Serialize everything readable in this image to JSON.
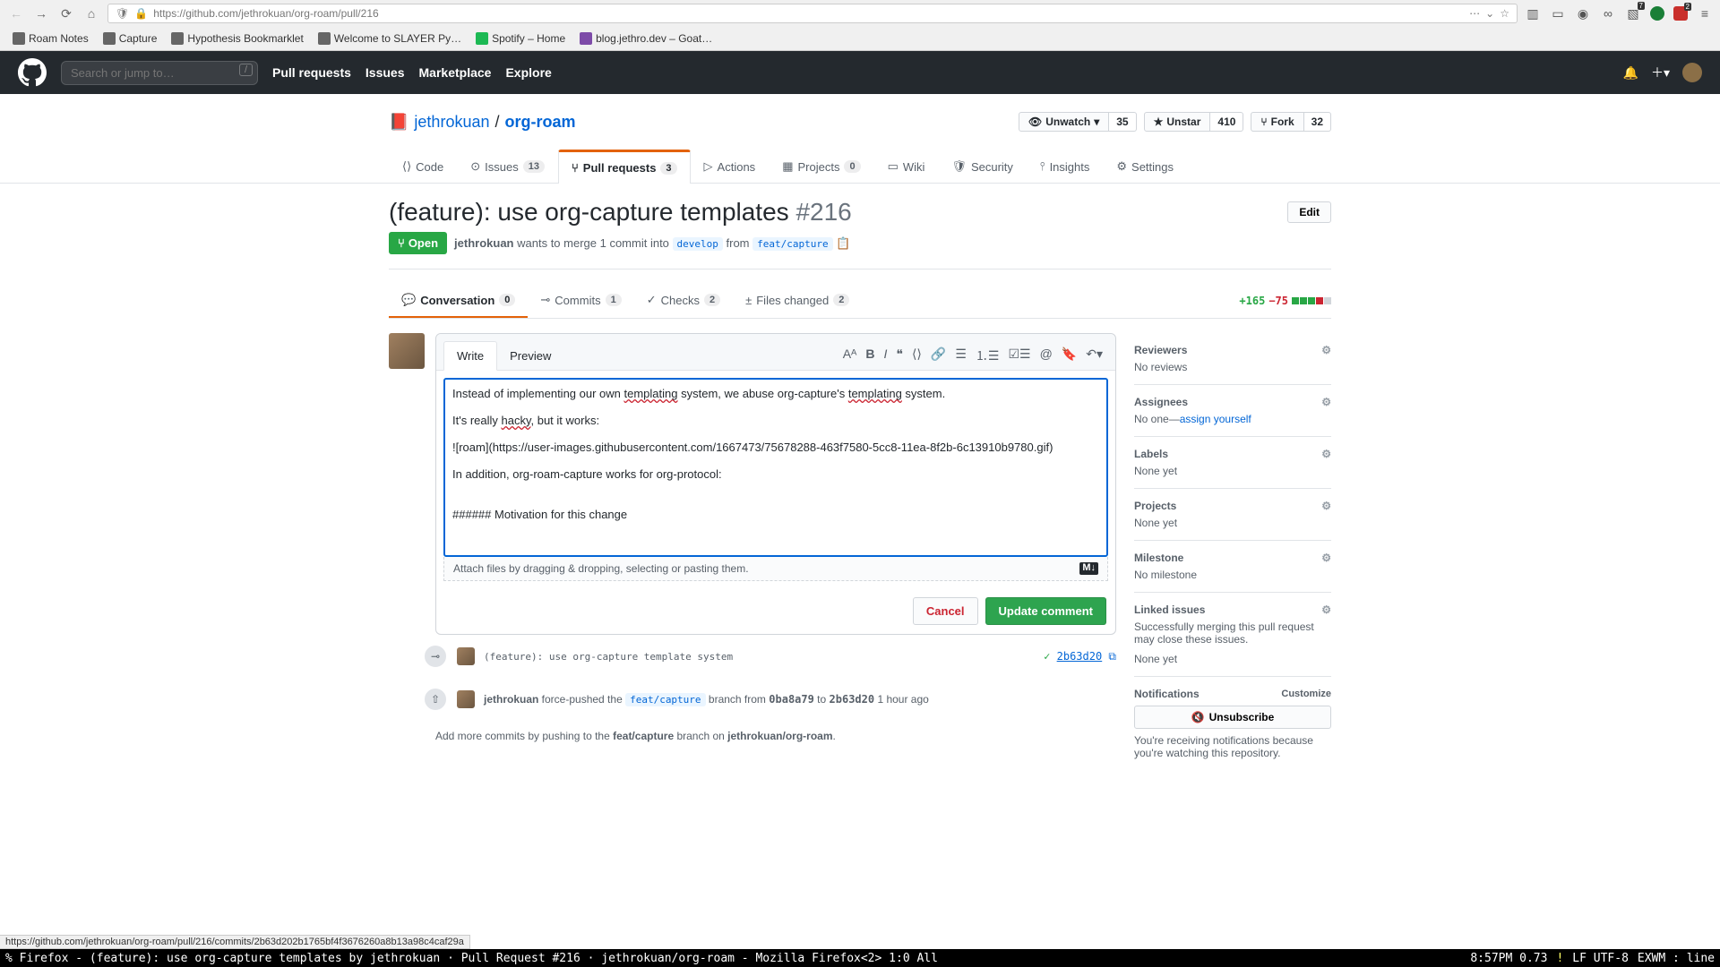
{
  "browser": {
    "url": "https://github.com/jethrokuan/org-roam/pull/216",
    "bookmarks": [
      "Roam Notes",
      "Capture",
      "Hypothesis Bookmarklet",
      "Welcome to SLAYER Py…",
      "Spotify – Home",
      "blog.jethro.dev – Goat…"
    ],
    "ext_badge": "7"
  },
  "gh_header": {
    "search_placeholder": "Search or jump to…",
    "nav": [
      "Pull requests",
      "Issues",
      "Marketplace",
      "Explore"
    ]
  },
  "repo": {
    "owner": "jethrokuan",
    "name": "org-roam",
    "watch_label": "Unwatch",
    "watch_count": "35",
    "star_label": "Unstar",
    "star_count": "410",
    "fork_label": "Fork",
    "fork_count": "32",
    "tabs": {
      "code": "Code",
      "issues": "Issues",
      "issues_count": "13",
      "pulls": "Pull requests",
      "pulls_count": "3",
      "actions": "Actions",
      "projects": "Projects",
      "projects_count": "0",
      "wiki": "Wiki",
      "security": "Security",
      "insights": "Insights",
      "settings": "Settings"
    }
  },
  "pr": {
    "title": "(feature): use org-capture templates",
    "number": "#216",
    "edit": "Edit",
    "state": "Open",
    "author": "jethrokuan",
    "merge_text": " wants to merge 1 commit into ",
    "base_branch": "develop",
    "from_text": " from ",
    "head_branch": "feat/capture",
    "tabs": {
      "conversation": "Conversation",
      "conversation_count": "0",
      "commits": "Commits",
      "commits_count": "1",
      "checks": "Checks",
      "checks_count": "2",
      "files": "Files changed",
      "files_count": "2"
    },
    "diff": {
      "add": "+165",
      "del": "−75"
    }
  },
  "comment": {
    "write": "Write",
    "preview": "Preview",
    "body": "Instead of implementing our own templating system, we abuse org-capture's templating system.\n\nIt's really hacky, but it works:\n\n![roam](https://user-images.githubusercontent.com/1667473/75678288-463f7580-5cc8-11ea-8f2b-6c13910b9780.gif)\n\nIn addition, org-roam-capture works for org-protocol:\n\n\n###### Motivation for this change",
    "attach_hint": "Attach files by dragging & dropping, selecting or pasting them.",
    "cancel": "Cancel",
    "submit": "Update comment"
  },
  "timeline": {
    "commit_msg": "(feature): use org-capture template system",
    "commit_hash": "2b63d20",
    "push_author": "jethrokuan",
    "push_text": " force-pushed the ",
    "push_branch": "feat/capture",
    "push_mid": " branch from ",
    "push_from": "0ba8a79",
    "push_to_word": " to ",
    "push_to": "2b63d20",
    "push_time": " 1 hour ago",
    "hint_pre": "Add more commits by pushing to the ",
    "hint_branch": "feat/capture",
    "hint_mid": " branch on ",
    "hint_repo": "jethrokuan/org-roam",
    "hint_end": "."
  },
  "sidebar": {
    "reviewers": {
      "title": "Reviewers",
      "body": "No reviews"
    },
    "assignees": {
      "title": "Assignees",
      "body_pre": "No one—",
      "assign_self": "assign yourself"
    },
    "labels": {
      "title": "Labels",
      "body": "None yet"
    },
    "projects": {
      "title": "Projects",
      "body": "None yet"
    },
    "milestone": {
      "title": "Milestone",
      "body": "No milestone"
    },
    "linked": {
      "title": "Linked issues",
      "desc": "Successfully merging this pull request may close these issues.",
      "body": "None yet"
    },
    "notifications": {
      "title": "Notifications",
      "customize": "Customize",
      "unsubscribe": "Unsubscribe",
      "desc": "You're receiving notifications because you're watching this repository."
    }
  },
  "hover_url": "https://github.com/jethrokuan/org-roam/pull/216/commits/2b63d202b1765bf4f3676260a8b13a98c4caf29a",
  "status": {
    "left": "% Firefox - (feature): use org-capture templates by jethrokuan · Pull Request #216 · jethrokuan/org-roam - Mozilla Firefox<2>   1:0 All",
    "time": "8:57PM 0.73",
    "warn": "!",
    "enc": "LF UTF-8",
    "mode": "EXWM : line"
  }
}
